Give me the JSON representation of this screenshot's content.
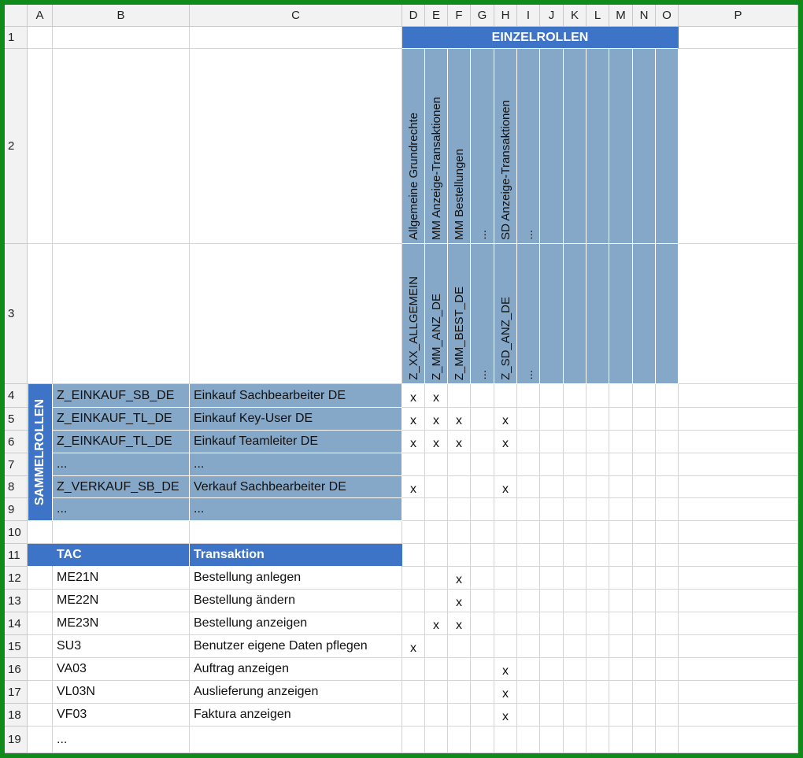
{
  "columns": [
    "A",
    "B",
    "C",
    "D",
    "E",
    "F",
    "G",
    "H",
    "I",
    "J",
    "K",
    "L",
    "M",
    "N",
    "O",
    "P"
  ],
  "rows": [
    "1",
    "2",
    "3",
    "4",
    "5",
    "6",
    "7",
    "8",
    "9",
    "10",
    "11",
    "12",
    "13",
    "14",
    "15",
    "16",
    "17",
    "18",
    "19"
  ],
  "einzelrollen_header": "EINZELROLLEN",
  "sammelrollen_label": "SAMMELROLLEN",
  "role_names": [
    "Allgemeine Grundrechte",
    "MM Anzeige-Transaktionen",
    "MM Bestellungen",
    "...",
    "SD Anzeige-Transaktionen",
    "..."
  ],
  "role_ids": [
    "Z_XX_ALLGEMEIN",
    "Z_MM_ANZ_DE",
    "Z_MM_BEST_DE",
    "...",
    "Z_SD_ANZ_DE",
    "..."
  ],
  "composite_roles": [
    {
      "id": "Z_EINKAUF_SB_DE",
      "desc": "Einkauf Sachbearbeiter DE",
      "marks": [
        "x",
        "x",
        "",
        "",
        "",
        ""
      ]
    },
    {
      "id": "Z_EINKAUF_TL_DE",
      "desc": "Einkauf Key-User DE",
      "marks": [
        "x",
        "x",
        "x",
        "",
        "x",
        ""
      ]
    },
    {
      "id": "Z_EINKAUF_TL_DE",
      "desc": "Einkauf Teamleiter DE",
      "marks": [
        "x",
        "x",
        "x",
        "",
        "x",
        ""
      ]
    },
    {
      "id": "...",
      "desc": "...",
      "marks": [
        "",
        "",
        "",
        "",
        "",
        ""
      ]
    },
    {
      "id": "Z_VERKAUF_SB_DE",
      "desc": "Verkauf Sachbearbeiter DE",
      "marks": [
        "x",
        "",
        "",
        "",
        "x",
        ""
      ]
    },
    {
      "id": "...",
      "desc": "...",
      "marks": [
        "",
        "",
        "",
        "",
        "",
        ""
      ]
    }
  ],
  "tac_header": {
    "tac": "TAC",
    "transaktion": "Transaktion"
  },
  "transactions": [
    {
      "tac": "ME21N",
      "name": "Bestellung anlegen",
      "marks": [
        "",
        "",
        "x",
        "",
        "",
        ""
      ]
    },
    {
      "tac": "ME22N",
      "name": "Bestellung ändern",
      "marks": [
        "",
        "",
        "x",
        "",
        "",
        ""
      ]
    },
    {
      "tac": "ME23N",
      "name": "Bestellung anzeigen",
      "marks": [
        "",
        "x",
        "x",
        "",
        "",
        ""
      ]
    },
    {
      "tac": "SU3",
      "name": "Benutzer eigene Daten pflegen",
      "marks": [
        "x",
        "",
        "",
        "",
        "",
        ""
      ]
    },
    {
      "tac": "VA03",
      "name": "Auftrag anzeigen",
      "marks": [
        "",
        "",
        "",
        "",
        "x",
        ""
      ]
    },
    {
      "tac": "VL03N",
      "name": "Auslieferung anzeigen",
      "marks": [
        "",
        "",
        "",
        "",
        "x",
        ""
      ]
    },
    {
      "tac": "VF03",
      "name": "Faktura anzeigen",
      "marks": [
        "",
        "",
        "",
        "",
        "x",
        ""
      ]
    },
    {
      "tac": "...",
      "name": "",
      "marks": [
        "",
        "",
        "",
        "",
        "",
        ""
      ]
    }
  ],
  "colors": {
    "frame": "#0f8a1b",
    "dark_blue": "#3e74c8",
    "light_blue": "#86a8c8",
    "header_gray": "#f2f2f2"
  }
}
